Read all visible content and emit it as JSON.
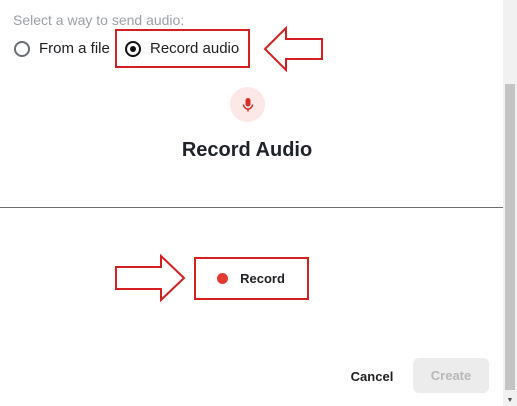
{
  "prompt": "Select a way to send audio:",
  "options": [
    {
      "label": "From a file",
      "selected": false
    },
    {
      "label": "Record audio",
      "selected": true
    }
  ],
  "title": "Record Audio",
  "record_button": "Record",
  "cancel_button": "Cancel",
  "create_button": "Create",
  "colors": {
    "annotation": "#d62020",
    "record_dot": "#e53935",
    "mic_bg": "#fde8e8"
  },
  "icons": {
    "mic": "microphone-icon",
    "record": "record-dot-icon"
  }
}
